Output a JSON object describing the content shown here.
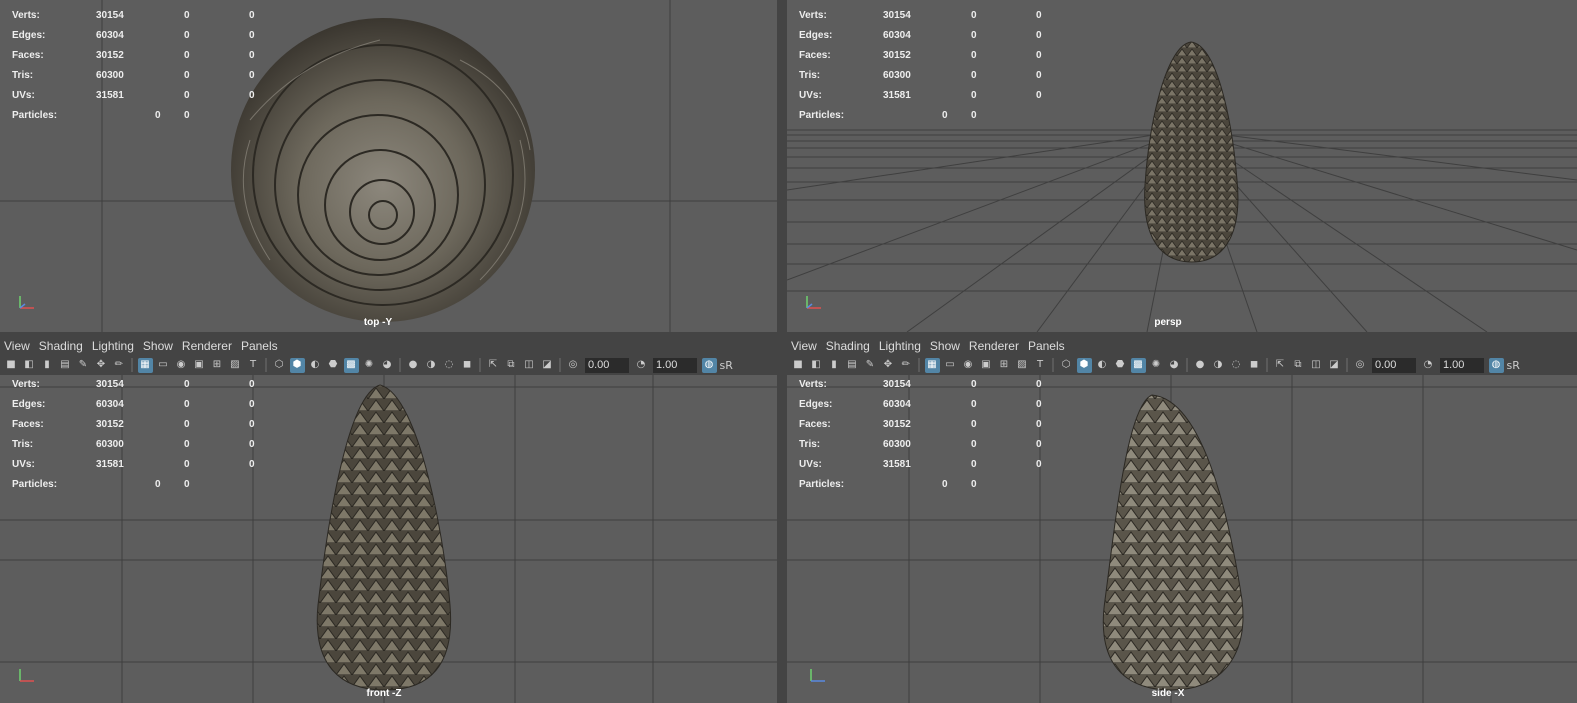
{
  "menu": [
    "View",
    "Shading",
    "Lighting",
    "Show",
    "Renderer",
    "Panels"
  ],
  "toolbar": {
    "exposure": "0.00",
    "gamma": "1.00",
    "color_mgmt": "sR"
  },
  "hud": {
    "rows": [
      {
        "label": "Verts:",
        "v1": "30154",
        "v2": "0",
        "v3": "0"
      },
      {
        "label": "Edges:",
        "v1": "60304",
        "v2": "0",
        "v3": "0"
      },
      {
        "label": "Faces:",
        "v1": "30152",
        "v2": "0",
        "v3": "0"
      },
      {
        "label": "Tris:",
        "v1": "60300",
        "v2": "0",
        "v3": "0"
      },
      {
        "label": "UVs:",
        "v1": "31581",
        "v2": "0",
        "v3": "0"
      }
    ],
    "particles": {
      "label": "Particles:",
      "v1": "0",
      "v2": "0"
    }
  },
  "viewports": {
    "top": {
      "camera": "top -Y"
    },
    "persp": {
      "camera": "persp"
    },
    "front": {
      "camera": "front -Z"
    },
    "side": {
      "camera": "side -X"
    }
  },
  "icons": {
    "camera": "camera-icon",
    "grid": "grid-icon",
    "wireframe": "wireframe-icon",
    "smooth_shade": "smooth-shade-icon",
    "textured": "textured-icon",
    "light": "light-icon",
    "xray": "xray-icon",
    "isolate": "isolate-icon",
    "exposure": "exposure-icon",
    "gamma": "gamma-icon",
    "color_management": "color-management-icon"
  },
  "colors": {
    "viewport_bg": "#5d5d5d",
    "accent": "#5285a6",
    "panel": "#444444",
    "grid": "#3f3f3f"
  }
}
